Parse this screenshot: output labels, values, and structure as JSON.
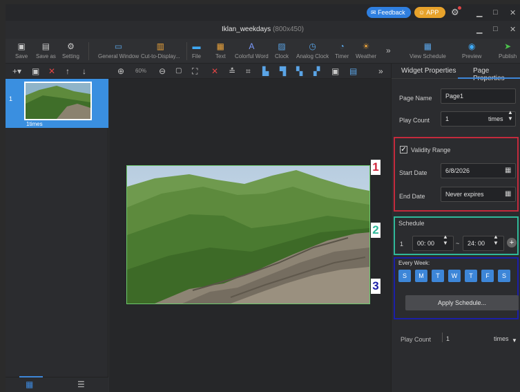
{
  "topbar": {
    "feedback": "Feedback",
    "app": "APP"
  },
  "window": {
    "title": "Iklan_weekdays",
    "resolution": "(800x450)"
  },
  "toolbar": {
    "items": [
      {
        "label": "Save",
        "icon": "save-icon"
      },
      {
        "label": "Save as",
        "icon": "save-as-icon"
      },
      {
        "label": "Setting",
        "icon": "gear-icon"
      },
      {
        "label": "General Window",
        "icon": "window-icon"
      },
      {
        "label": "Cut-to-Display...",
        "icon": "cut-icon"
      },
      {
        "label": "File",
        "icon": "folder-icon"
      },
      {
        "label": "Text",
        "icon": "text-icon"
      },
      {
        "label": "Colorful Word",
        "icon": "colorful-word-icon"
      },
      {
        "label": "Clock",
        "icon": "clock-icon"
      },
      {
        "label": "Analog Clock",
        "icon": "analog-clock-icon"
      },
      {
        "label": "Timer",
        "icon": "timer-icon"
      },
      {
        "label": "Weather",
        "icon": "weather-icon"
      },
      {
        "label": "View Schedule",
        "icon": "calendar-icon"
      },
      {
        "label": "Preview",
        "icon": "eye-icon"
      },
      {
        "label": "Publish",
        "icon": "send-icon"
      }
    ]
  },
  "row2": {
    "zoom": "60%"
  },
  "pages": [
    {
      "index": "1",
      "caption": "1times"
    }
  ],
  "right": {
    "tab_widget": "Widget Properties",
    "tab_page": "Page Properties",
    "page_name_label": "Page Name",
    "page_name_value": "Page1",
    "play_count_label": "Play Count",
    "play_count_value": "1",
    "times": "times",
    "validity_label": "Validity Range",
    "start_date_label": "Start Date",
    "start_date_value": "6/8/2026",
    "end_date_label": "End Date",
    "end_date_value": "Never expires",
    "schedule_label": "Schedule",
    "schedule_index": "1",
    "schedule_start": "00: 00",
    "schedule_tilde": "~",
    "schedule_end": "24: 00",
    "every_week_label": "Every Week:",
    "days": [
      "S",
      "M",
      "T",
      "W",
      "T",
      "F",
      "S"
    ],
    "apply_button": "Apply Schedule...",
    "play_count_bottom_label": "Play Count",
    "play_count_bottom_value": "1",
    "times_bottom": "times"
  },
  "callouts": [
    "1",
    "2",
    "3"
  ],
  "colors": {
    "callout1": "#d0253a",
    "callout2": "#2fb99a",
    "callout3": "#1b1fa8",
    "accent": "#3d86d8"
  }
}
